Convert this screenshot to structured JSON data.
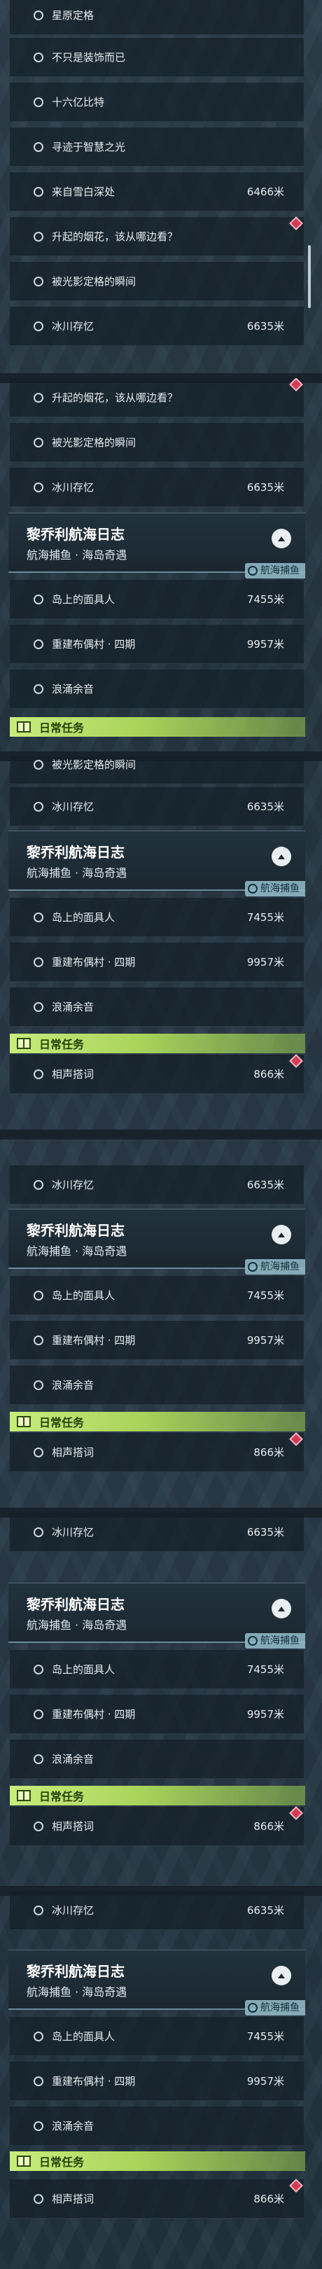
{
  "quests": {
    "xingyuan": "星原定格",
    "buzhishi": "不只是装饰而已",
    "shiliu": "十六亿比特",
    "xunji": "寻迹于智慧之光",
    "xueyu": {
      "label": "来自雪白深处",
      "dist": "6466米"
    },
    "yanhua": "升起的烟花，该从哪边看？",
    "dingge": "被光影定格的瞬间",
    "bingchuan": {
      "label": "冰川存忆",
      "dist": "6635米"
    },
    "daoshang": {
      "label": "岛上的面具人",
      "dist": "7455米"
    },
    "chongjian": {
      "label": "重建布偶村 · 四期",
      "dist": "9957米"
    },
    "langyong": "浪涌余音",
    "xiangsheng": {
      "label": "相声搭词",
      "dist": "866米"
    }
  },
  "voyage": {
    "title": "黎乔利航海日志",
    "subtitle": "航海捕鱼 · 海岛奇遇",
    "tag": "航海捕鱼"
  },
  "daily": {
    "label": "日常任务"
  },
  "icons": {
    "quest": "circle-outline-icon",
    "track": "red-diamond-marker-icon",
    "collapse": "chevron-up-icon",
    "daily": "book-icon",
    "tag": "fishing-icon"
  },
  "colors": {
    "accent_green": "#c9ec7c",
    "marker_red": "#d23a55",
    "text": "#e7edf1"
  }
}
